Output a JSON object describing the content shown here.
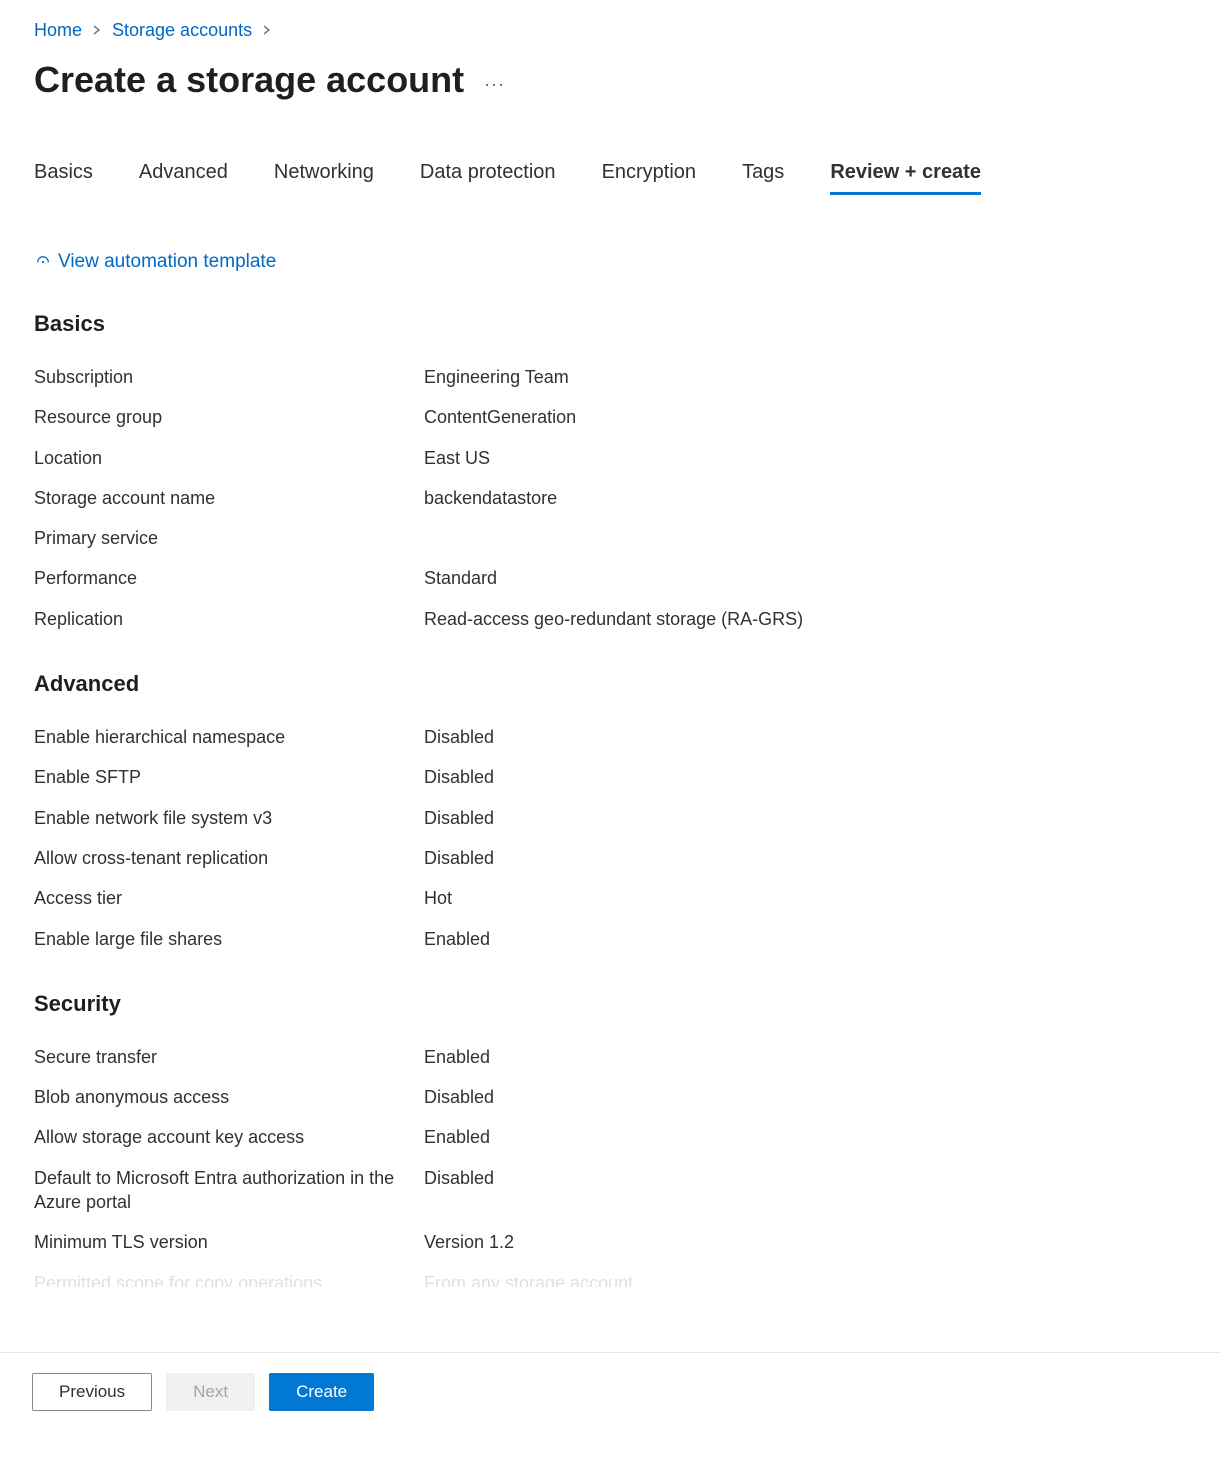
{
  "breadcrumb": {
    "home": "Home",
    "storage_accounts": "Storage accounts"
  },
  "title": "Create a storage account",
  "tabs": [
    {
      "label": "Basics",
      "active": false
    },
    {
      "label": "Advanced",
      "active": false
    },
    {
      "label": "Networking",
      "active": false
    },
    {
      "label": "Data protection",
      "active": false
    },
    {
      "label": "Encryption",
      "active": false
    },
    {
      "label": "Tags",
      "active": false
    },
    {
      "label": "Review + create",
      "active": true
    }
  ],
  "automation_link": "View automation template",
  "sections": {
    "basics": {
      "heading": "Basics",
      "rows": [
        {
          "label": "Subscription",
          "value": "Engineering Team"
        },
        {
          "label": "Resource group",
          "value": "ContentGeneration"
        },
        {
          "label": "Location",
          "value": "East US"
        },
        {
          "label": "Storage account name",
          "value": "backendatastore"
        },
        {
          "label": "Primary service",
          "value": ""
        },
        {
          "label": "Performance",
          "value": "Standard"
        },
        {
          "label": "Replication",
          "value": "Read-access geo-redundant storage (RA-GRS)"
        }
      ]
    },
    "advanced": {
      "heading": "Advanced",
      "rows": [
        {
          "label": "Enable hierarchical namespace",
          "value": "Disabled"
        },
        {
          "label": "Enable SFTP",
          "value": "Disabled"
        },
        {
          "label": "Enable network file system v3",
          "value": "Disabled"
        },
        {
          "label": "Allow cross-tenant replication",
          "value": "Disabled"
        },
        {
          "label": "Access tier",
          "value": "Hot"
        },
        {
          "label": "Enable large file shares",
          "value": "Enabled"
        }
      ]
    },
    "security": {
      "heading": "Security",
      "rows": [
        {
          "label": "Secure transfer",
          "value": "Enabled"
        },
        {
          "label": "Blob anonymous access",
          "value": "Disabled"
        },
        {
          "label": "Allow storage account key access",
          "value": "Enabled"
        },
        {
          "label": "Default to Microsoft Entra authorization in the Azure portal",
          "value": "Disabled"
        },
        {
          "label": "Minimum TLS version",
          "value": "Version 1.2"
        },
        {
          "label": "Permitted scope for copy operations",
          "value": "From any storage account"
        }
      ]
    }
  },
  "footer": {
    "previous": "Previous",
    "next": "Next",
    "create": "Create"
  }
}
